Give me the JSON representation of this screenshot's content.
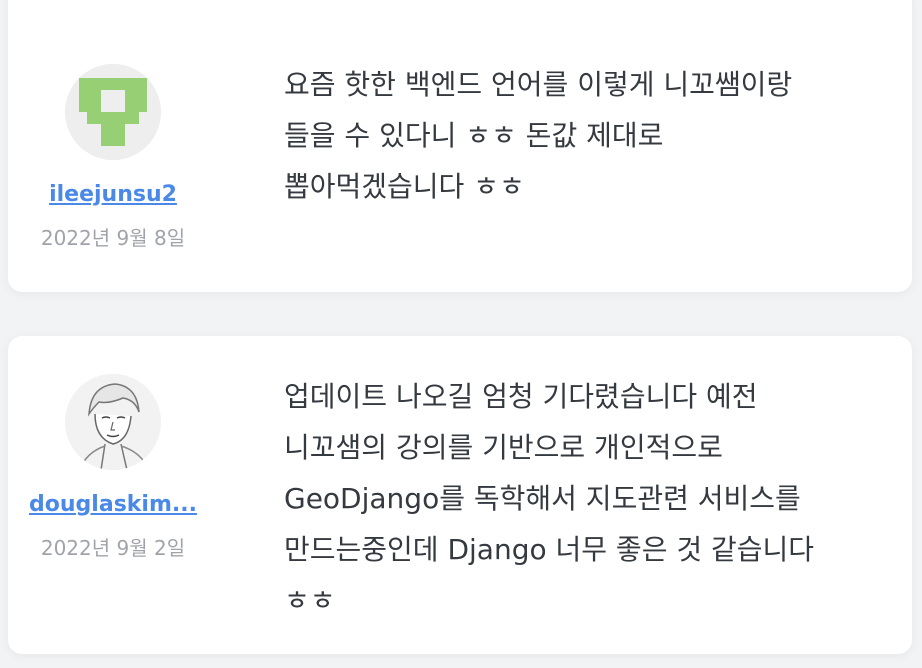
{
  "comments": [
    {
      "username": "ileejunsu2",
      "date": "2022년 9월 8일",
      "avatar_icon": "identicon-icon",
      "avatar_color": "#97cf75",
      "lines": [
        "요즘 핫한 백엔드 언어를 이렇게 니꼬쌤이랑",
        "들을 수 있다니 ㅎㅎ 돈값 제대로",
        "뽑아먹겠습니다 ㅎㅎ"
      ]
    },
    {
      "username": "douglaskim...",
      "date": "2022년 9월 2일",
      "avatar_icon": "portrait-sketch-icon",
      "lines": [
        "업데이트 나오길 엄청 기다렸습니다 예전",
        "니꼬샘의 강의를 기반으로 개인적으로",
        "GeoDjango를 독학해서 지도관련 서비스를",
        "만드는중인데 Django 너무 좋은 것 같습니다",
        "ㅎㅎ"
      ]
    }
  ],
  "colors": {
    "background": "#f1f3f5",
    "card": "#ffffff",
    "link": "#4a89e8",
    "muted_text": "#a0a4aa",
    "body_text": "#343a40"
  }
}
